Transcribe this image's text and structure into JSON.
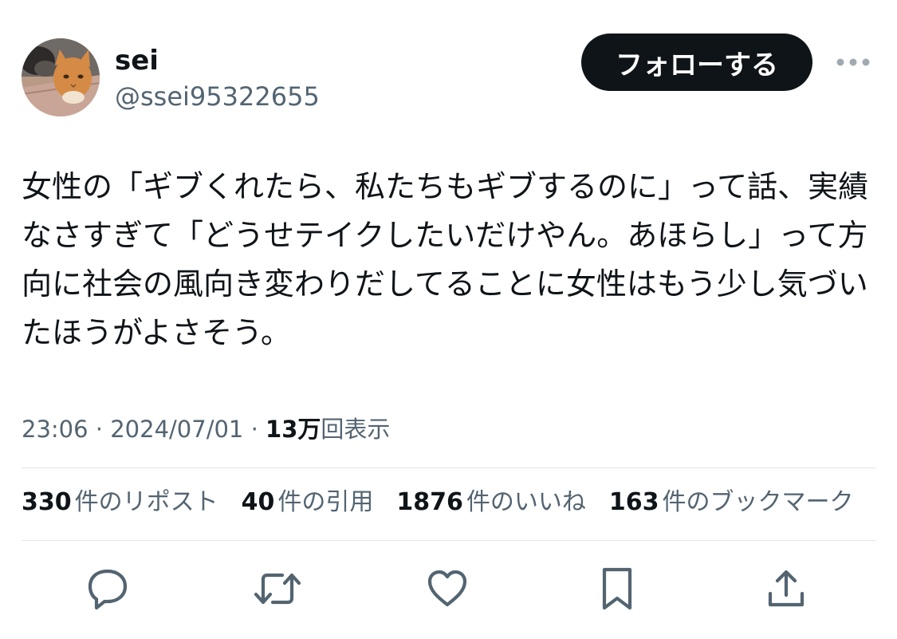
{
  "user": {
    "display_name": "sei",
    "handle": "@ssei95322655"
  },
  "follow_button_label": "フォローする",
  "tweet": {
    "text": "女性の「ギブくれたら、私たちもギブするのに」って話、実績なさすぎて「どうせテイクしたいだけやん。あほらし」って方向に社会の風向き変わりだしてることに女性はもう少し気づいたほうがよさそう。",
    "time": "23:06",
    "separator": "·",
    "date": "2024/07/01",
    "views_count": "13万",
    "views_label": "回表示"
  },
  "stats": {
    "reposts": {
      "count": "330",
      "label": "件のリポスト"
    },
    "quotes": {
      "count": "40",
      "label": "件の引用"
    },
    "likes": {
      "count": "1876",
      "label": "件のいいね"
    },
    "bookmarks": {
      "count": "163",
      "label": "件のブックマーク"
    }
  },
  "icons": {
    "more": "more-horizontal-icon",
    "reply": "reply-bubble-icon",
    "retweet": "retweet-icon",
    "like": "heart-icon",
    "bookmark": "bookmark-icon",
    "share": "share-icon"
  },
  "colors": {
    "text_primary": "#0f1419",
    "text_secondary": "#536471",
    "divider": "#e1e6ea",
    "follow_bg": "#0f1419",
    "follow_text": "#ffffff"
  }
}
